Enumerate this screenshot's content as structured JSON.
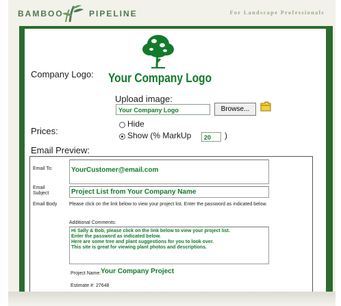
{
  "brand": {
    "left": "BAMBOO",
    "right": "PIPELINE",
    "tagline": "For Landscape Professionals"
  },
  "company_logo": {
    "label": "Company Logo:",
    "logo_text": "Your Company Logo",
    "upload_label": "Upload image:",
    "upload_value": "Your Company Logo",
    "browse_label": "Browse..."
  },
  "prices": {
    "label": "Prices:",
    "hide_label": "Hide",
    "show_label": "Show (% MarkUp",
    "markup_value": "20",
    "markup_close": ")",
    "selected": "Show"
  },
  "email_preview": {
    "label": "Email Preview:",
    "email_to_label": "Email To:",
    "email_to_value": "YourCustomer@email.com",
    "subject_label_line1": "Email",
    "subject_label_line2": "Subject",
    "subject_value": "Project List from Your Company Name",
    "body_label": "Email Body",
    "body_text": "Please click on the link below to view your project list. Enter the password as indicated below.",
    "comments_label": "Additional Comments:",
    "comments_lines": [
      "Hi Sally & Bob, please click on the link below to view your project list.",
      "Enter the password as indicated below.",
      "Here are some tree and plant suggestions for you to look over.",
      "This site is great for viewing plant photos and descriptions."
    ],
    "project_name_label": "Project Name:",
    "project_name_value": "Your Company Project",
    "estimate_text": "Estimate #: 27648"
  },
  "colors": {
    "brand_green": "#2d6a2f",
    "text_green": "#137a2c"
  }
}
